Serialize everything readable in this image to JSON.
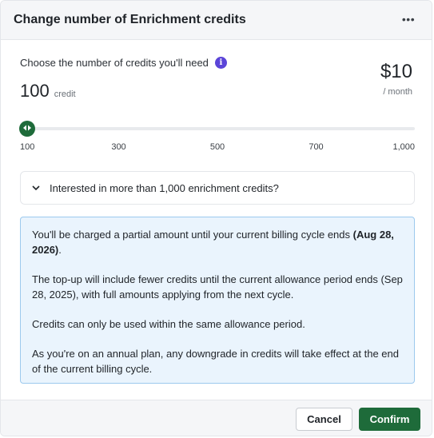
{
  "dialog": {
    "title": "Change number of Enrichment credits",
    "more_icon": "ellipsis-horizontal-icon",
    "more_glyph": "•••"
  },
  "credits": {
    "prompt": "Choose the number of credits you'll need",
    "info_icon": "info-icon",
    "info_glyph": "i",
    "amount": "100",
    "unit": "credit",
    "price": "$10",
    "per": "/ month"
  },
  "slider": {
    "min": 100,
    "max": 1000,
    "value": 100,
    "accent": "#1e6b3a",
    "ticks": [
      "100",
      "300",
      "500",
      "700",
      "1,000"
    ]
  },
  "expander": {
    "label": "Interested in more than 1,000 enrichment credits?",
    "chevron_icon": "chevron-down-icon"
  },
  "notice": {
    "p1_prefix": "You'll be charged a partial amount until your current billing cycle ends ",
    "p1_bold": "(Aug 28, 2026)",
    "p1_suffix": ".",
    "p2": "The top-up will include fewer credits until the current allowance period ends (Sep 28, 2025), with full amounts applying from the next cycle.",
    "p3": "Credits can only be used within the same allowance period.",
    "p4": "As you're on an annual plan, any downgrade in credits will take effect at the end of the current billing cycle.",
    "border_color": "#9cc9ee",
    "background": "#eaf4fd"
  },
  "footer": {
    "cancel_label": "Cancel",
    "confirm_label": "Confirm"
  }
}
